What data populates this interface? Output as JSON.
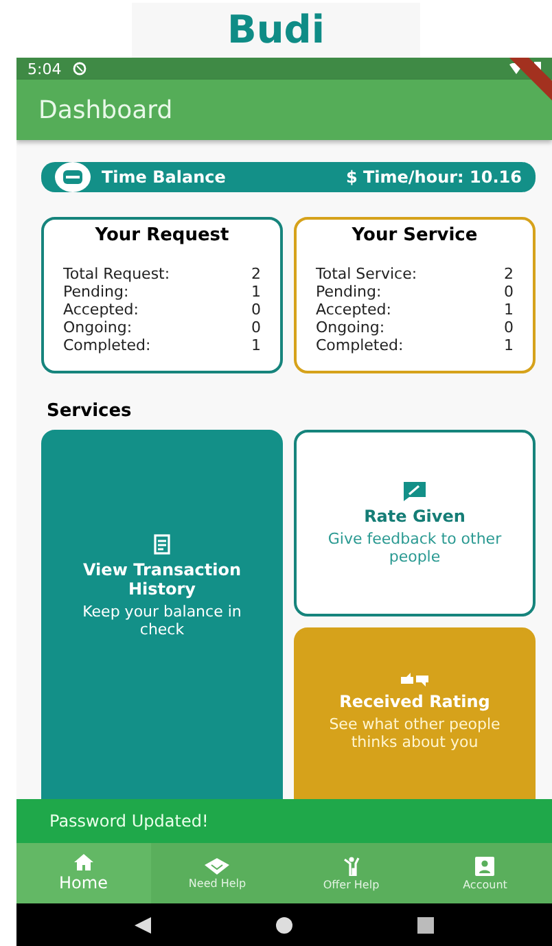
{
  "caption": "Budi",
  "status_bar": {
    "time": "5:04"
  },
  "app_bar": {
    "title": "Dashboard"
  },
  "balance": {
    "label": "Time Balance",
    "value": "$ Time/hour: 10.16"
  },
  "stat_cards": [
    {
      "title": "Your Request",
      "kind": "request",
      "rows": [
        {
          "label": "Total Request:",
          "value": "2"
        },
        {
          "label": "Pending:",
          "value": "1"
        },
        {
          "label": "Accepted:",
          "value": "0"
        },
        {
          "label": "Ongoing:",
          "value": "0"
        },
        {
          "label": "Completed:",
          "value": "1"
        }
      ]
    },
    {
      "title": "Your Service",
      "kind": "service",
      "rows": [
        {
          "label": "Total Service:",
          "value": "2"
        },
        {
          "label": "Pending:",
          "value": "0"
        },
        {
          "label": "Accepted:",
          "value": "1"
        },
        {
          "label": "Ongoing:",
          "value": "0"
        },
        {
          "label": "Completed:",
          "value": "1"
        }
      ]
    }
  ],
  "services": {
    "heading": "Services",
    "tiles": [
      {
        "kind": "history",
        "title": "View Transaction History",
        "subtitle": "Keep your balance in check"
      },
      {
        "kind": "rate",
        "title": "Rate Given",
        "subtitle": "Give feedback to other people"
      },
      {
        "kind": "received",
        "title": "Received Rating",
        "subtitle": "See what other people thinks about you"
      }
    ]
  },
  "snackbar": {
    "message": "Password Updated!"
  },
  "bottom_nav": [
    {
      "label": "Home",
      "kind": "home",
      "selected": true
    },
    {
      "label": "Need Help",
      "kind": "need",
      "selected": false
    },
    {
      "label": "Offer Help",
      "kind": "offer",
      "selected": false
    },
    {
      "label": "Account",
      "kind": "account",
      "selected": false
    }
  ]
}
